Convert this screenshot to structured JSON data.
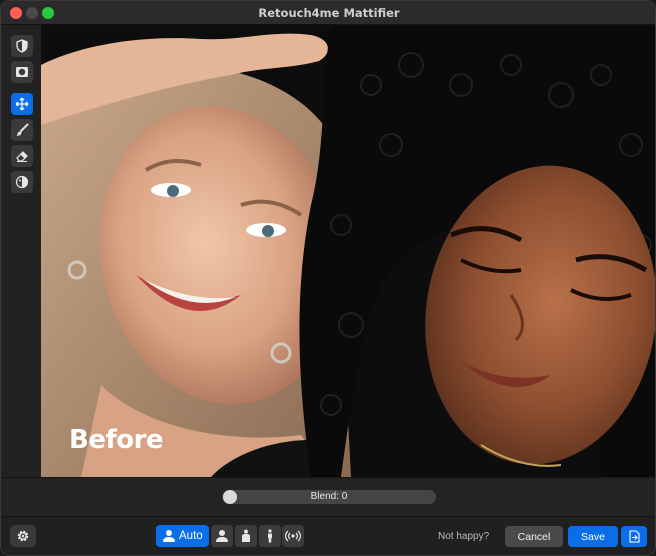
{
  "window": {
    "title": "Retouch4me Mattifier"
  },
  "tools": [
    {
      "icon": "shield-icon",
      "active": false
    },
    {
      "icon": "mask-icon",
      "active": false
    },
    {
      "icon": "move-icon",
      "active": true
    },
    {
      "icon": "brush-icon",
      "active": false
    },
    {
      "icon": "eraser-icon",
      "active": false
    },
    {
      "icon": "contrast-icon",
      "active": false
    }
  ],
  "photo": {
    "overlay_label": "Before"
  },
  "blend": {
    "label": "Blend: 0",
    "value": 0
  },
  "modes": {
    "auto_label": "Auto"
  },
  "footer": {
    "not_happy": "Not happy?",
    "cancel": "Cancel",
    "save": "Save"
  },
  "colors": {
    "accent": "#0a6ee8",
    "close": "#ff5f57",
    "maximize": "#28c840"
  }
}
